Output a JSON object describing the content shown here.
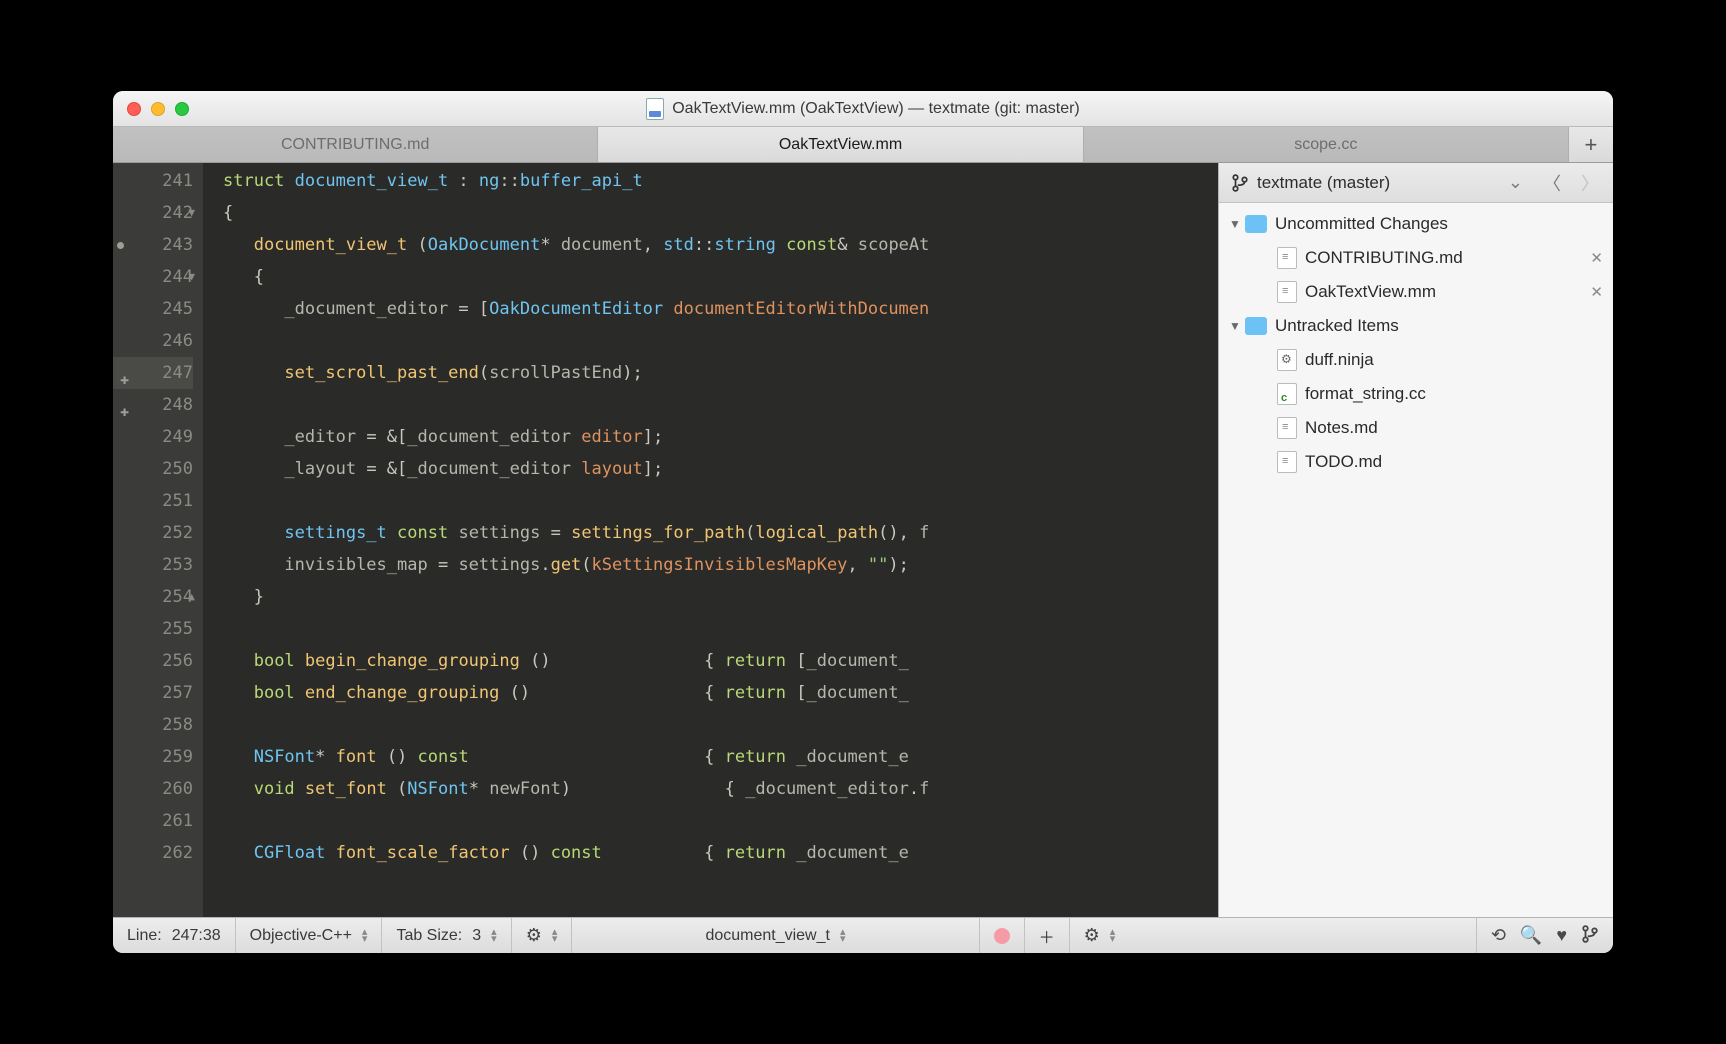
{
  "window": {
    "title": "OakTextView.mm (OakTextView) — textmate (git: master)"
  },
  "tabs": [
    {
      "label": "CONTRIBUTING.md",
      "active": false
    },
    {
      "label": "OakTextView.mm",
      "active": true
    },
    {
      "label": "scope.cc",
      "active": false
    }
  ],
  "gutter": {
    "start": 241,
    "end": 262,
    "marks": {
      "243": "dot",
      "247": "plus",
      "248": "plus"
    },
    "folds": {
      "242": "down",
      "244": "down",
      "254": "up"
    },
    "highlighted": 247
  },
  "code_lines": [
    {
      "n": 241,
      "seg": [
        [
          "kw",
          "struct "
        ],
        [
          "type",
          "document_view_t"
        ],
        [
          "p",
          " : "
        ],
        [
          "type",
          "ng"
        ],
        [
          "p",
          "::"
        ],
        [
          "type",
          "buffer_api_t"
        ]
      ]
    },
    {
      "n": 242,
      "seg": [
        [
          "p",
          "{"
        ]
      ]
    },
    {
      "n": 243,
      "seg": [
        [
          "p",
          "   "
        ],
        [
          "fn",
          "document_view_t"
        ],
        [
          "p",
          " ("
        ],
        [
          "type",
          "OakDocument"
        ],
        [
          "p",
          "* "
        ],
        [
          "id",
          "document"
        ],
        [
          "p",
          ", "
        ],
        [
          "type",
          "std"
        ],
        [
          "p",
          "::"
        ],
        [
          "type",
          "string"
        ],
        [
          "p",
          " "
        ],
        [
          "kw",
          "const"
        ],
        [
          "p",
          "& "
        ],
        [
          "id",
          "scopeAt"
        ]
      ]
    },
    {
      "n": 244,
      "seg": [
        [
          "p",
          "   {"
        ]
      ]
    },
    {
      "n": 245,
      "seg": [
        [
          "p",
          "      "
        ],
        [
          "id",
          "_document_editor"
        ],
        [
          "p",
          " = ["
        ],
        [
          "type",
          "OakDocumentEditor"
        ],
        [
          "p",
          " "
        ],
        [
          "mcall",
          "documentEditorWithDocumen"
        ]
      ]
    },
    {
      "n": 246,
      "seg": [
        [
          "p",
          ""
        ]
      ]
    },
    {
      "n": 247,
      "seg": [
        [
          "p",
          "      "
        ],
        [
          "fn",
          "set_scroll_past_end"
        ],
        [
          "p",
          "("
        ],
        [
          "id",
          "scrollPastEnd"
        ],
        [
          "p",
          ");"
        ]
      ]
    },
    {
      "n": 248,
      "seg": [
        [
          "p",
          ""
        ]
      ]
    },
    {
      "n": 249,
      "seg": [
        [
          "p",
          "      "
        ],
        [
          "id",
          "_editor"
        ],
        [
          "p",
          " = &["
        ],
        [
          "id",
          "_document_editor"
        ],
        [
          "p",
          " "
        ],
        [
          "mcall",
          "editor"
        ],
        [
          "p",
          "];"
        ]
      ]
    },
    {
      "n": 250,
      "seg": [
        [
          "p",
          "      "
        ],
        [
          "id",
          "_layout"
        ],
        [
          "p",
          " = &["
        ],
        [
          "id",
          "_document_editor"
        ],
        [
          "p",
          " "
        ],
        [
          "mcall",
          "layout"
        ],
        [
          "p",
          "];"
        ]
      ]
    },
    {
      "n": 251,
      "seg": [
        [
          "p",
          ""
        ]
      ]
    },
    {
      "n": 252,
      "seg": [
        [
          "p",
          "      "
        ],
        [
          "type",
          "settings_t"
        ],
        [
          "p",
          " "
        ],
        [
          "kw",
          "const"
        ],
        [
          "p",
          " "
        ],
        [
          "id",
          "settings"
        ],
        [
          "p",
          " = "
        ],
        [
          "fn",
          "settings_for_path"
        ],
        [
          "p",
          "("
        ],
        [
          "fn",
          "logical_path"
        ],
        [
          "p",
          "(), "
        ],
        [
          "id",
          "f"
        ]
      ]
    },
    {
      "n": 253,
      "seg": [
        [
          "p",
          "      "
        ],
        [
          "id",
          "invisibles_map"
        ],
        [
          "p",
          " = "
        ],
        [
          "id",
          "settings"
        ],
        [
          "p",
          "."
        ],
        [
          "fn",
          "get"
        ],
        [
          "p",
          "("
        ],
        [
          "mcall",
          "kSettingsInvisiblesMapKey"
        ],
        [
          "p",
          ", "
        ],
        [
          "str",
          "\"\""
        ],
        [
          "p",
          ");"
        ]
      ]
    },
    {
      "n": 254,
      "seg": [
        [
          "p",
          "   }"
        ]
      ]
    },
    {
      "n": 255,
      "seg": [
        [
          "p",
          ""
        ]
      ]
    },
    {
      "n": 256,
      "seg": [
        [
          "p",
          "   "
        ],
        [
          "kw",
          "bool"
        ],
        [
          "p",
          " "
        ],
        [
          "fn",
          "begin_change_grouping"
        ],
        [
          "p",
          " ()"
        ],
        [
          "p",
          "               { "
        ],
        [
          "kw",
          "return"
        ],
        [
          "p",
          " ["
        ],
        [
          "id",
          "_document_"
        ]
      ]
    },
    {
      "n": 257,
      "seg": [
        [
          "p",
          "   "
        ],
        [
          "kw",
          "bool"
        ],
        [
          "p",
          " "
        ],
        [
          "fn",
          "end_change_grouping"
        ],
        [
          "p",
          " ()"
        ],
        [
          "p",
          "                 { "
        ],
        [
          "kw",
          "return"
        ],
        [
          "p",
          " ["
        ],
        [
          "id",
          "_document_"
        ]
      ]
    },
    {
      "n": 258,
      "seg": [
        [
          "p",
          ""
        ]
      ]
    },
    {
      "n": 259,
      "seg": [
        [
          "p",
          "   "
        ],
        [
          "type",
          "NSFont"
        ],
        [
          "p",
          "* "
        ],
        [
          "fn",
          "font"
        ],
        [
          "p",
          " () "
        ],
        [
          "kw",
          "const"
        ],
        [
          "p",
          "                       { "
        ],
        [
          "kw",
          "return"
        ],
        [
          "p",
          " "
        ],
        [
          "id",
          "_document_e"
        ]
      ]
    },
    {
      "n": 260,
      "seg": [
        [
          "p",
          "   "
        ],
        [
          "kw",
          "void"
        ],
        [
          "p",
          " "
        ],
        [
          "fn",
          "set_font"
        ],
        [
          "p",
          " ("
        ],
        [
          "type",
          "NSFont"
        ],
        [
          "p",
          "* "
        ],
        [
          "id",
          "newFont"
        ],
        [
          "p",
          ")"
        ],
        [
          "p",
          "               { "
        ],
        [
          "id",
          "_document_editor"
        ],
        [
          "p",
          "."
        ],
        [
          "id",
          "f"
        ]
      ]
    },
    {
      "n": 261,
      "seg": [
        [
          "p",
          ""
        ]
      ]
    },
    {
      "n": 262,
      "seg": [
        [
          "p",
          "   "
        ],
        [
          "type",
          "CGFloat"
        ],
        [
          "p",
          " "
        ],
        [
          "fn",
          "font_scale_factor"
        ],
        [
          "p",
          " () "
        ],
        [
          "kw",
          "const"
        ],
        [
          "p",
          "          { "
        ],
        [
          "kw",
          "return"
        ],
        [
          "p",
          " "
        ],
        [
          "id",
          "_document_e"
        ]
      ]
    }
  ],
  "sidebar": {
    "head": "textmate (master)",
    "groups": [
      {
        "label": "Uncommitted Changes",
        "items": [
          {
            "name": "CONTRIBUTING.md",
            "icon": "md",
            "close": true
          },
          {
            "name": "OakTextView.mm",
            "icon": "md",
            "close": true
          }
        ]
      },
      {
        "label": "Untracked Items",
        "items": [
          {
            "name": "duff.ninja",
            "icon": "ninja"
          },
          {
            "name": "format_string.cc",
            "icon": "cc"
          },
          {
            "name": "Notes.md",
            "icon": "md"
          },
          {
            "name": "TODO.md",
            "icon": "md"
          }
        ]
      }
    ]
  },
  "statusbar": {
    "line_label": "Line:",
    "line_pos": "247:38",
    "language": "Objective-C++",
    "tabsize_label": "Tab Size:",
    "tabsize_value": "3",
    "symbol": "document_view_t"
  }
}
